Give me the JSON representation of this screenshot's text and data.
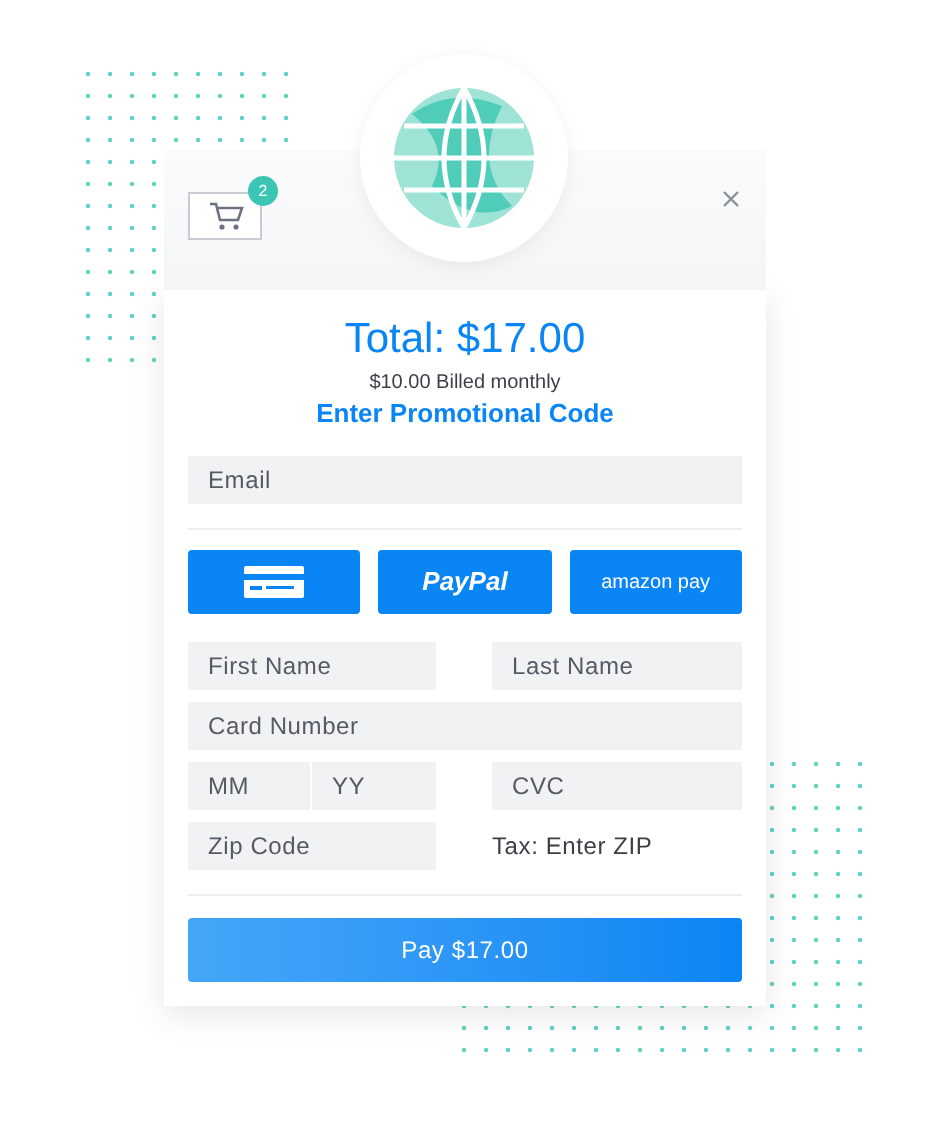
{
  "cart": {
    "count": "2"
  },
  "summary": {
    "total": "Total: $17.00",
    "billing": "$10.00 Billed monthly",
    "promo_link": "Enter Promotional Code"
  },
  "email": {
    "placeholder": "Email"
  },
  "payment_methods": [
    {
      "kind": "card"
    },
    {
      "kind": "paypal",
      "label": "PayPal"
    },
    {
      "kind": "amazon",
      "label": "amazon pay"
    }
  ],
  "first_name": {
    "placeholder": "First Name"
  },
  "last_name": {
    "placeholder": "Last Name"
  },
  "card_number": {
    "placeholder": "Card Number"
  },
  "expiry_month": {
    "placeholder": "MM"
  },
  "expiry_year": {
    "placeholder": "YY"
  },
  "cvc": {
    "placeholder": "CVC"
  },
  "zip": {
    "placeholder": "Zip Code"
  },
  "tax_note": "Tax: Enter ZIP",
  "pay_button": "Pay $17.00"
}
